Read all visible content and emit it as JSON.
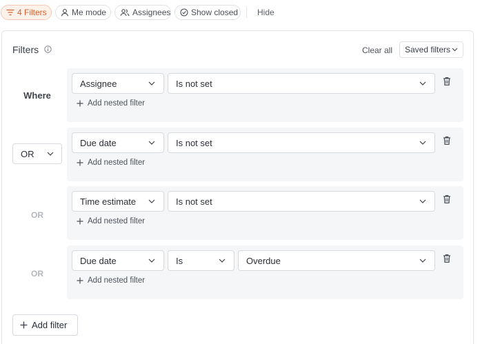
{
  "toolbar": {
    "filters_chip": "4 Filters",
    "me_mode_chip": "Me mode",
    "assignees_chip": "Assignees",
    "show_closed_chip": "Show closed",
    "hide_label": "Hide"
  },
  "panel": {
    "title": "Filters",
    "clear_all": "Clear all",
    "saved_filters": "Saved filters",
    "add_filter": "Add filter"
  },
  "connectors": {
    "where": "Where",
    "or_select": "OR",
    "or_3": "OR",
    "or_4": "OR"
  },
  "groups": [
    {
      "field": "Assignee",
      "operator": "Is not set",
      "value": "",
      "nested": "Add nested filter"
    },
    {
      "field": "Due date",
      "operator": "Is not set",
      "value": "",
      "nested": "Add nested filter"
    },
    {
      "field": "Time estimate",
      "operator": "Is not set",
      "value": "",
      "nested": "Add nested filter"
    },
    {
      "field": "Due date",
      "operator": "Is",
      "value": "Overdue",
      "nested": "Add nested filter"
    }
  ],
  "colors": {
    "accent": "#d5602b",
    "accent_bg": "#fdf1ea",
    "group_bg": "#f5f6f7",
    "border": "#d6d9dd"
  }
}
